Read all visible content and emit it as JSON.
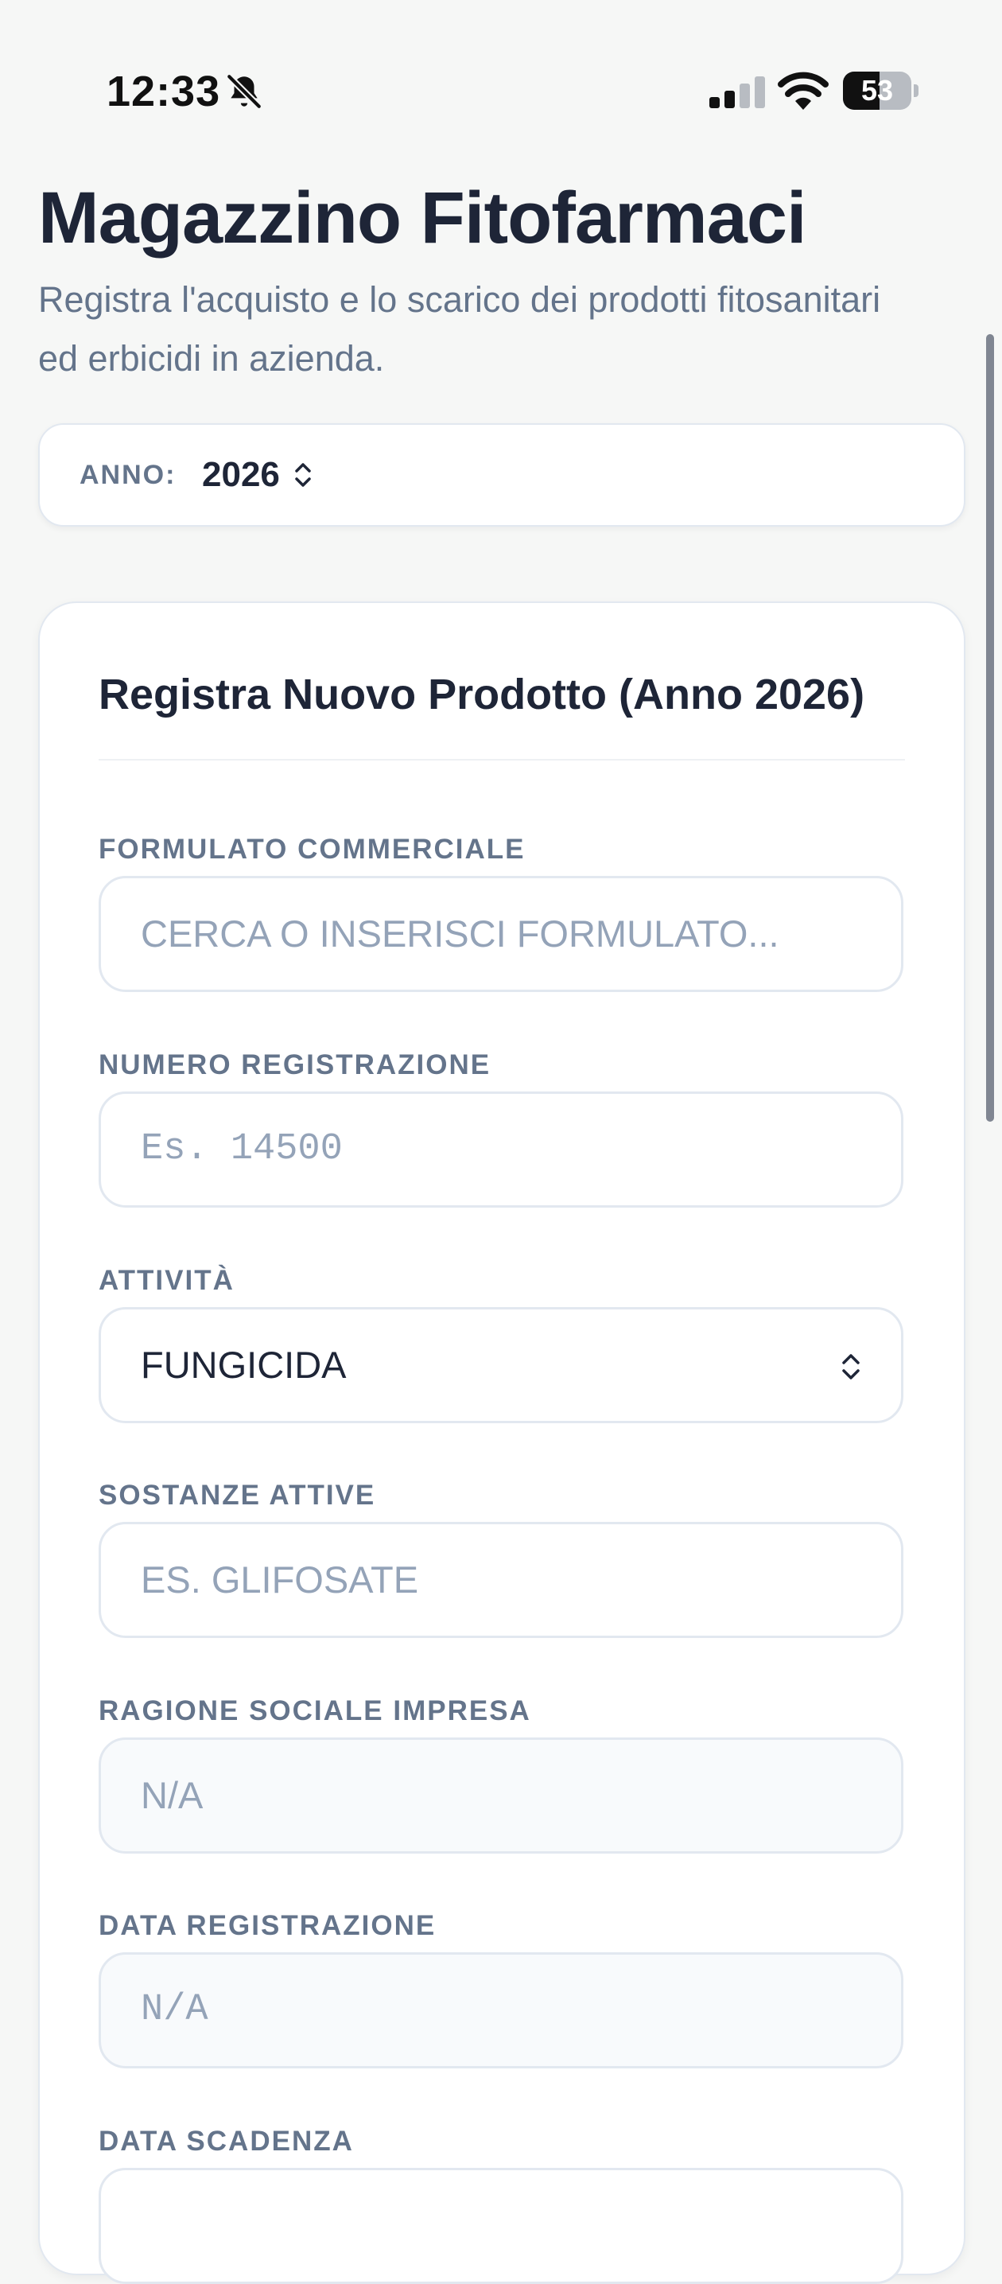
{
  "status_bar": {
    "time": "12:33",
    "battery": "53",
    "battery_level": 0.53,
    "icons": [
      "bell-slash-icon",
      "cellular-signal-icon",
      "wifi-icon",
      "battery-icon"
    ]
  },
  "header": {
    "title": "Magazzino Fitofarmaci",
    "subtitle": "Registra l'acquisto e lo scarico dei prodotti fitosanitari ed erbicidi in azienda."
  },
  "year_selector": {
    "label": "ANNO:",
    "value": "2026"
  },
  "form": {
    "title": "Registra Nuovo Prodotto (Anno 2026)",
    "fields": [
      {
        "label": "FORMULATO COMMERCIALE",
        "placeholder": "CERCA O INSERISCI FORMULATO...",
        "value": ""
      },
      {
        "label": "NUMERO REGISTRAZIONE",
        "placeholder": "Es. 14500",
        "value": ""
      },
      {
        "label": "ATTIVITÀ",
        "placeholder": "",
        "value": "FUNGICIDA"
      },
      {
        "label": "SOSTANZE ATTIVE",
        "placeholder": "ES. GLIFOSATE",
        "value": ""
      },
      {
        "label": "RAGIONE SOCIALE IMPRESA",
        "placeholder": "N/A",
        "value": ""
      },
      {
        "label": "DATA REGISTRAZIONE",
        "placeholder": "N/A",
        "value": ""
      },
      {
        "label": "DATA SCADENZA",
        "placeholder": "",
        "value": ""
      }
    ]
  },
  "colors": {
    "background": "#f6f7f6",
    "card": "#ffffff",
    "title": "#1e2537",
    "muted": "#64748b",
    "placeholder": "#94a3b8",
    "border": "#e2e8f0"
  }
}
